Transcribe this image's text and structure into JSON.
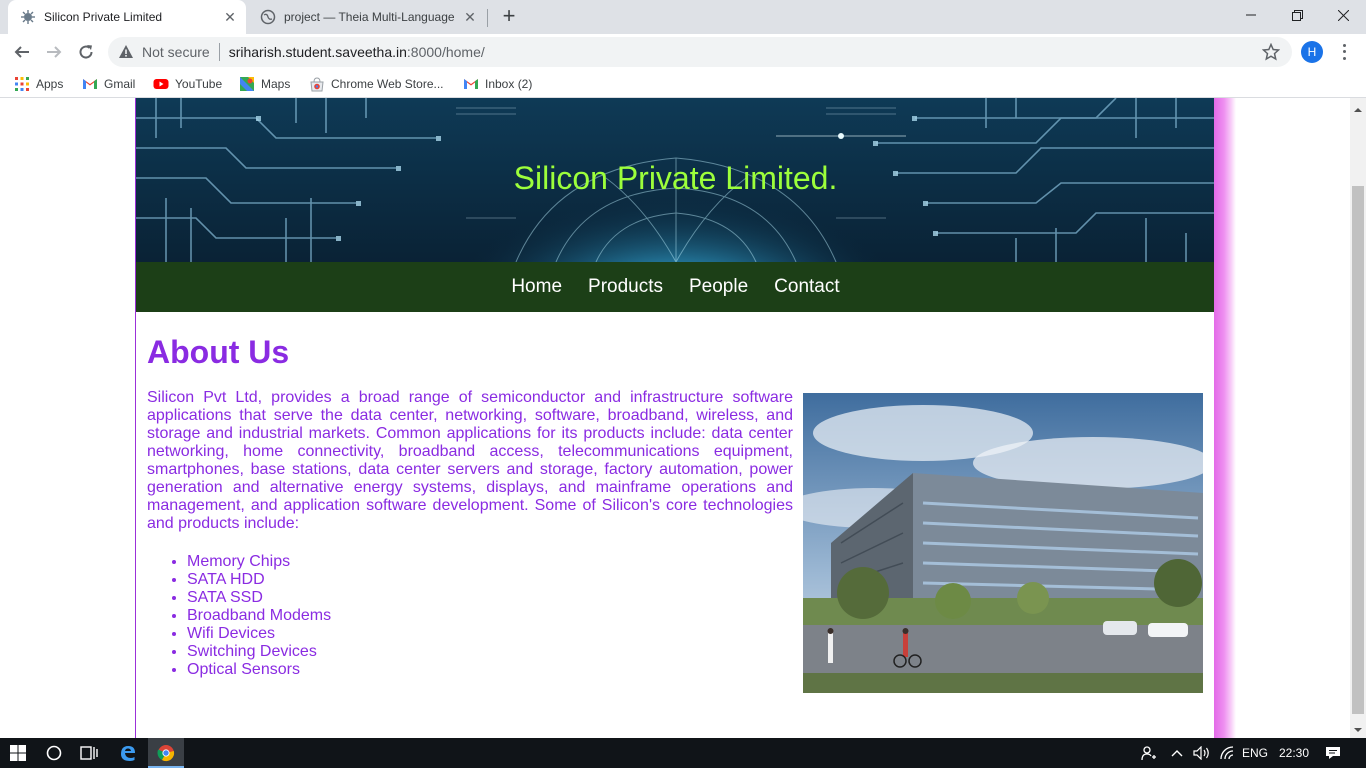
{
  "browser": {
    "tabs": [
      {
        "title": "Silicon Private Limited",
        "active": true
      },
      {
        "title": "project — Theia Multi-Language",
        "active": false
      }
    ],
    "address": {
      "security_label": "Not secure",
      "url_host": "sriharish.student.saveetha.in",
      "url_path": ":8000/home/"
    },
    "profile_initial": "H",
    "bookmarks": [
      "Apps",
      "Gmail",
      "YouTube",
      "Maps",
      "Chrome Web Store...",
      "Inbox (2)"
    ]
  },
  "site": {
    "banner_title": "Silicon Private Limited.",
    "nav": [
      "Home",
      "Products",
      "People",
      "Contact"
    ],
    "about": {
      "heading": "About Us",
      "paragraph": "Silicon Pvt Ltd, provides a broad range of semiconductor and infrastructure software applications that serve the data center, networking, software, broadband, wireless, and storage and industrial markets. Common applications for its products include: data center networking, home connectivity, broadband access, telecommunications equipment, smartphones, base stations, data center servers and storage, factory automation, power generation and alternative energy systems, displays, and mainframe operations and management, and application software development. Some of Silicon's core technologies and products include:",
      "products": [
        "Memory Chips",
        "SATA HDD",
        "SATA SSD",
        "Broadband Modems",
        "Wifi Devices",
        "Switching Devices",
        "Optical Sensors"
      ]
    }
  },
  "taskbar": {
    "language": "ENG",
    "time": "22:30"
  },
  "colors": {
    "accent": "#8a2be2",
    "banner_text": "#9dff3b",
    "nav_bg": "#1c3f17",
    "glow": "#e36ae8"
  }
}
